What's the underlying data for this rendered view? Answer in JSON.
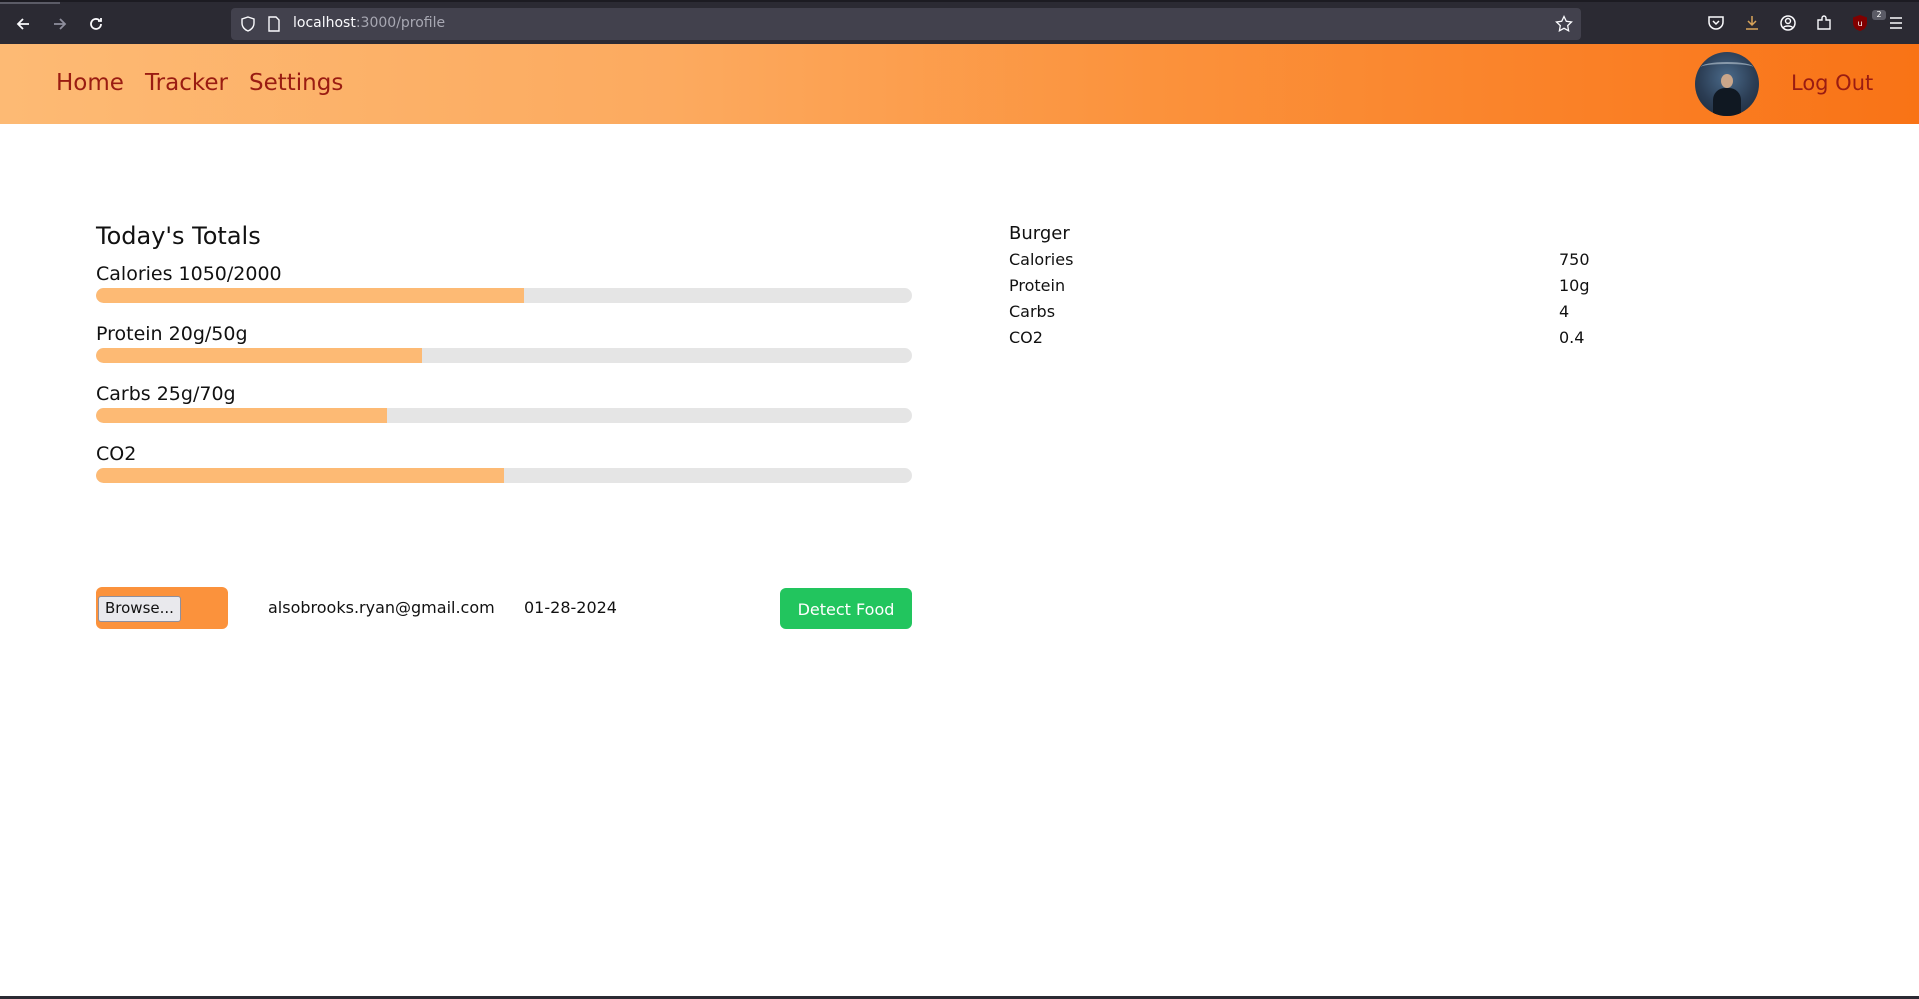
{
  "browser": {
    "url_host": "localhost",
    "url_path": ":3000/profile",
    "extension_badge": "2"
  },
  "header": {
    "nav": [
      {
        "label": "Home"
      },
      {
        "label": "Tracker"
      },
      {
        "label": "Settings"
      }
    ],
    "logout_label": "Log Out"
  },
  "totals": {
    "title": "Today's Totals",
    "metrics": [
      {
        "label": "Calories 1050/2000",
        "progress": 0.525
      },
      {
        "label": "Protein 20g/50g",
        "progress": 0.4
      },
      {
        "label": "Carbs 25g/70g",
        "progress": 0.357
      },
      {
        "label": "CO2",
        "progress": 0.5
      }
    ]
  },
  "upload": {
    "browse_label": "Browse...",
    "email": "alsobrooks.ryan@gmail.com",
    "date": "01-28-2024",
    "detect_label": "Detect Food"
  },
  "food": {
    "name": "Burger",
    "rows": [
      {
        "key": "Calories",
        "value": "750"
      },
      {
        "key": "Protein",
        "value": "10g"
      },
      {
        "key": "Carbs",
        "value": "4"
      },
      {
        "key": "CO2",
        "value": "0.4"
      }
    ]
  },
  "colors": {
    "header_gradient_start": "#fdba74",
    "header_gradient_end": "#f97316",
    "nav_text": "#9a1c12",
    "bar_fill": "#fdba74",
    "bar_track": "#e5e5e5",
    "detect_button": "#22c55e"
  }
}
